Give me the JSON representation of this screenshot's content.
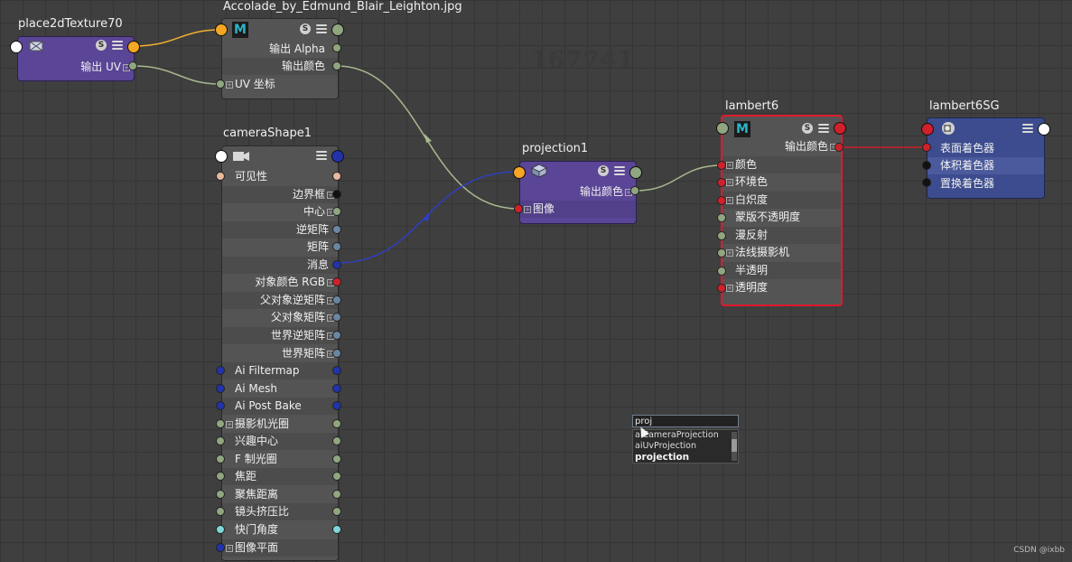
{
  "watermark": "167741",
  "credit": "CSDN @ixbb",
  "colors": {
    "grid_bg": "#3f3f3f",
    "node_body_gray": "#545454",
    "node_row_alt": "#4c4c4c",
    "node_purple": "#5b4596",
    "node_blue": "#3c4c8e",
    "selected_border": "#e0192c",
    "port_yellow": "#f5a623",
    "port_green": "#8fa680",
    "port_red": "#d0202a",
    "port_blue": "#2233aa",
    "port_slate": "#6a86a0",
    "wire_yellow": "#f0b030",
    "wire_green": "#a8b88e",
    "wire_blue": "#2f3fc0",
    "wire_red": "#c81e2a"
  },
  "nodes": {
    "place2d": {
      "title": "place2dTexture70",
      "icon": "place2d-icon",
      "rows": [
        "输出 UV"
      ]
    },
    "file": {
      "title": "Accolade_by_Edmund_Blair_Leighton.jpg",
      "icon": "maya-m-icon",
      "icon_text": "M",
      "rows": [
        "输出 Alpha",
        "输出颜色",
        "UV 坐标"
      ]
    },
    "camera": {
      "title": "cameraShape1",
      "icon": "camera-icon",
      "rows": [
        "可见性",
        "边界框",
        "中心",
        "逆矩阵",
        "矩阵",
        "消息",
        "对象颜色 RGB",
        "父对象逆矩阵",
        "父对象矩阵",
        "世界逆矩阵",
        "世界矩阵",
        "Ai Filtermap",
        "Ai Mesh",
        "Ai Post Bake",
        "摄影机光圈",
        "兴趣中心",
        "F 制光圈",
        "焦距",
        "聚焦距离",
        "镜头挤压比",
        "快门角度",
        "图像平面"
      ]
    },
    "projection": {
      "title": "projection1",
      "icon": "projection-icon",
      "rows": [
        "输出颜色",
        "图像"
      ]
    },
    "lambert": {
      "title": "lambert6",
      "icon": "maya-m-icon",
      "icon_text": "M",
      "rows": [
        "输出颜色",
        "颜色",
        "环境色",
        "白炽度",
        "蒙版不透明度",
        "漫反射",
        "法线摄影机",
        "半透明",
        "透明度"
      ]
    },
    "sg": {
      "title": "lambert6SG",
      "icon": "shading-group-icon",
      "rows": [
        "表面着色器",
        "体积着色器",
        "置换着色器"
      ]
    }
  },
  "badge_s": "S",
  "popup": {
    "input_value": "proj",
    "items": [
      "aiCameraProjection",
      "aiUvProjection",
      "projection"
    ]
  }
}
